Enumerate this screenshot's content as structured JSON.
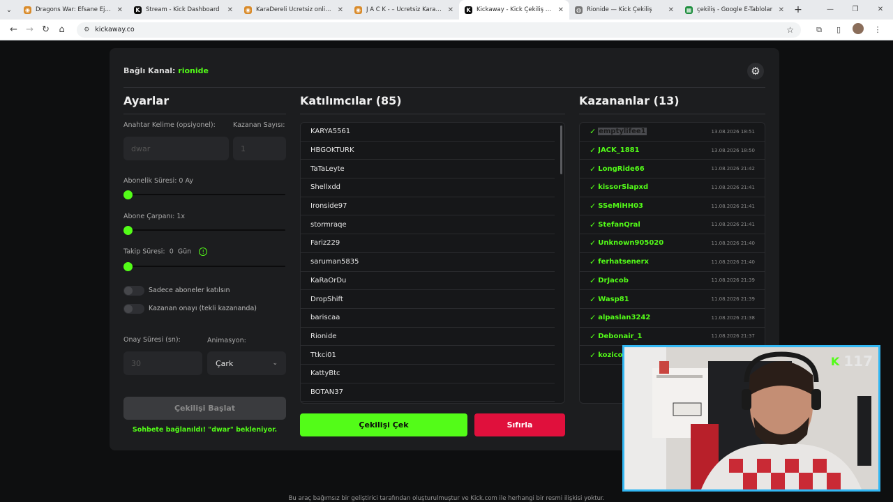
{
  "browser": {
    "tabs": [
      {
        "title": "Dragons War: Efsane Ejderhalar",
        "fav_color": "#d98b2b",
        "fav_glyph": "◉"
      },
      {
        "title": "Stream - Kick Dashboard",
        "fav_color": "#0b0b0b",
        "fav_glyph": "K"
      },
      {
        "title": "KaraDereli Ücretsiz online rol y",
        "fav_color": "#d98b2b",
        "fav_glyph": "◉"
      },
      {
        "title": "J A C K - – Ücretsiz Karakter G",
        "fav_color": "#d98b2b",
        "fav_glyph": "◉"
      },
      {
        "title": "Kickaway - Kick Çekiliş Aracı",
        "fav_color": "#0b0b0b",
        "fav_glyph": "K",
        "active": true
      },
      {
        "title": "Rionide — Kick Çekiliş",
        "fav_color": "#777777",
        "fav_glyph": "◍"
      },
      {
        "title": "çekiliş - Google E-Tablolar",
        "fav_color": "#1e8e3e",
        "fav_glyph": "▦"
      }
    ],
    "url": "kickaway.co"
  },
  "header": {
    "channel_label": "Bağlı Kanal:",
    "channel_name": "rionide"
  },
  "settings": {
    "title": "Ayarlar",
    "keyword_label": "Anahtar Kelime (opsiyonel):",
    "keyword_placeholder": "dwar",
    "winners_label": "Kazanan Sayısı:",
    "winners_placeholder": "1",
    "sub_duration_label": "Abonelik Süresi: 0 Ay",
    "sub_multiplier_label": "Abone Çarpanı: 1x",
    "follow_label": "Takip Süresi:",
    "follow_value": "0",
    "follow_unit": "Gün",
    "sub_only_label": "Sadece aboneler katılsın",
    "winner_confirm_label": "Kazanan onayı (tekli kazananda)",
    "confirm_time_label": "Onay Süresi (sn):",
    "confirm_time_placeholder": "30",
    "animation_label": "Animasyon:",
    "animation_value": "Çark",
    "start_button": "Çekilişi Başlat",
    "status_text": "Sohbete bağlanıldı! \"dwar\" bekleniyor."
  },
  "participants": {
    "title": "Katılımcılar (85)",
    "items": [
      "KARYA5561",
      "HBGOKTURK",
      "TaTaLeyte",
      "Shellxdd",
      "Ironside97",
      "stormraqe",
      "Fariz229",
      "saruman5835",
      "KaRaOrDu",
      "DropShift",
      "bariscaa",
      "Rionide",
      "Ttkci01",
      "KattyBtc",
      "BOTAN37"
    ],
    "draw_button": "Çekilişi Çek",
    "reset_button": "Sıfırla"
  },
  "winners": {
    "title": "Kazananlar (13)",
    "items": [
      {
        "name": "emptylifee1",
        "date": "13.08.2026 18:51"
      },
      {
        "name": "JACK_1881",
        "date": "13.08.2026 18:50"
      },
      {
        "name": "LongRide66",
        "date": "11.08.2026 21:42"
      },
      {
        "name": "kissorSlapxd",
        "date": "11.08.2026 21:41"
      },
      {
        "name": "SSeMiHH03",
        "date": "11.08.2026 21:41"
      },
      {
        "name": "StefanQral",
        "date": "11.08.2026 21:41"
      },
      {
        "name": "Unknown905020",
        "date": "11.08.2026 21:40"
      },
      {
        "name": "ferhatsenerx",
        "date": "11.08.2026 21:40"
      },
      {
        "name": "DrJacob",
        "date": "11.08.2026 21:39"
      },
      {
        "name": "Wasp81",
        "date": "11.08.2026 21:39"
      },
      {
        "name": "alpaslan3242",
        "date": "11.08.2026 21:38"
      },
      {
        "name": "Debonair_1",
        "date": "11.08.2026 21:37"
      },
      {
        "name": "kozicod",
        "date": ""
      }
    ]
  },
  "footer": {
    "text": "Bu araç bağımsız bir geliştirici tarafından oluşturulmuştur ve Kick.com ile herhangi bir resmi ilişkisi yoktur."
  },
  "webcam": {
    "counter": "117"
  },
  "colors": {
    "accent": "#53fc18",
    "danger": "#e0103c",
    "cam_border": "#32b7f3"
  }
}
